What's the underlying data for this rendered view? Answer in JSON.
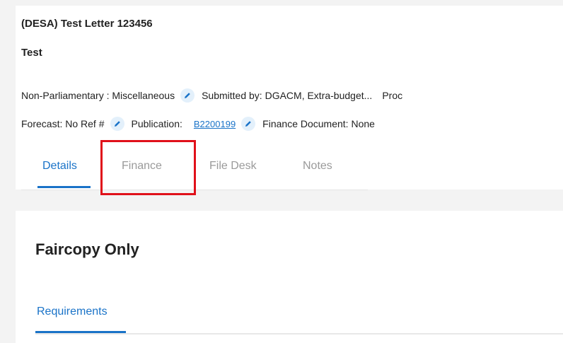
{
  "header": {
    "title": "(DESA) Test Letter 123456",
    "subtitle": "Test"
  },
  "meta": {
    "category": "Non-Parliamentary : Miscellaneous",
    "submitted_by": "Submitted by:  DGACM, Extra-budget...",
    "truncated_next": "Proc",
    "forecast": "Forecast:  No Ref #",
    "publication_label": "Publication:",
    "publication_link": "B2200199",
    "finance_document": "Finance Document:  None"
  },
  "tabs": [
    {
      "label": "Details",
      "active": true
    },
    {
      "label": "Finance",
      "active": false
    },
    {
      "label": "File Desk",
      "active": false
    },
    {
      "label": "Notes",
      "active": false
    }
  ],
  "section": {
    "title": "Faircopy Only",
    "subtab": "Requirements"
  },
  "colors": {
    "accent": "#1a73c8",
    "highlight": "#e0101a",
    "tab_inactive": "#9a9a9a"
  },
  "icons": {
    "edit": "pencil-icon"
  }
}
